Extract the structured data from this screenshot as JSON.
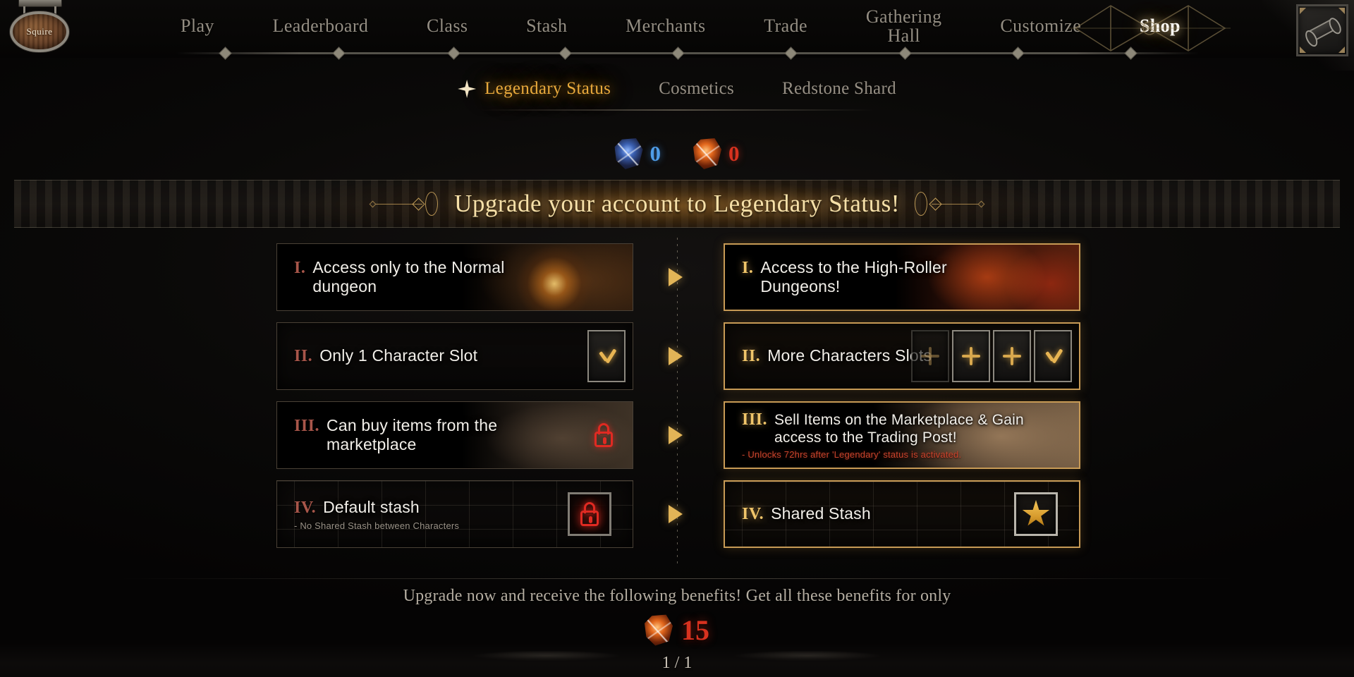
{
  "header": {
    "profile_badge": "Squire",
    "nav_items": [
      {
        "label": "Play",
        "active": false
      },
      {
        "label": "Leaderboard",
        "active": false
      },
      {
        "label": "Class",
        "active": false
      },
      {
        "label": "Stash",
        "active": false
      },
      {
        "label": "Merchants",
        "active": false
      },
      {
        "label": "Trade",
        "active": false
      },
      {
        "label": "Gathering Hall",
        "active": false
      },
      {
        "label": "Customize",
        "active": false
      },
      {
        "label": "Shop",
        "active": true
      }
    ],
    "scroll_icon": "scroll-icon"
  },
  "subtabs": [
    {
      "label": "Legendary Status",
      "active": true,
      "icon": "four-point-star-icon"
    },
    {
      "label": "Cosmetics",
      "active": false
    },
    {
      "label": "Redstone Shard",
      "active": false
    }
  ],
  "currencies": [
    {
      "name": "blue-shard",
      "value": "0",
      "color": "#4f9de8"
    },
    {
      "name": "red-shard",
      "value": "0",
      "color": "#d8321f"
    }
  ],
  "banner": {
    "title": "Upgrade your account to Legendary Status!"
  },
  "comparison": {
    "rows": [
      {
        "free": {
          "numeral": "I.",
          "title": "Access only to the Normal dungeon",
          "subtitle": "",
          "art": "campfire"
        },
        "legendary": {
          "numeral": "I.",
          "title": "Access to the High-Roller Dungeons!",
          "subtitle": "",
          "art": "highroller"
        }
      },
      {
        "free": {
          "numeral": "II.",
          "title": "Only 1 Character Slot",
          "subtitle": "",
          "slots": [
            "check"
          ]
        },
        "legendary": {
          "numeral": "II.",
          "title": "More Characters Slots",
          "subtitle": "",
          "slots": [
            "plus-faint",
            "plus",
            "plus",
            "check"
          ]
        }
      },
      {
        "free": {
          "numeral": "III.",
          "title": "Can buy items from the marketplace",
          "subtitle": "",
          "art": "merchant-face",
          "icon": "lock-icon"
        },
        "legendary": {
          "numeral": "III.",
          "title": "Sell Items on the Marketplace & Gain access to the Trading Post!",
          "subtitle": "- Unlocks 72hrs after 'Legendary' status is activated.",
          "art": "merchant-face-bright"
        }
      },
      {
        "free": {
          "numeral": "IV.",
          "title": "Default stash",
          "subtitle": "- No Shared Stash between Characters",
          "art": "stash-grid",
          "icon": "locked-stash-icon"
        },
        "legendary": {
          "numeral": "IV.",
          "title": "Shared Stash",
          "subtitle": "",
          "art": "stash-grid",
          "icon": "star-stash-icon"
        }
      }
    ]
  },
  "footer": {
    "promo_text": "Upgrade now and receive the following benefits! Get all these benefits for only",
    "price": "15",
    "price_currency_icon": "red-shard-icon",
    "pagination": "1 / 1"
  },
  "colors": {
    "gold": "#e8a93c",
    "gold_border": "#c79a55",
    "red": "#d8321f",
    "blue": "#4f9de8",
    "text": "#f2efe9"
  }
}
